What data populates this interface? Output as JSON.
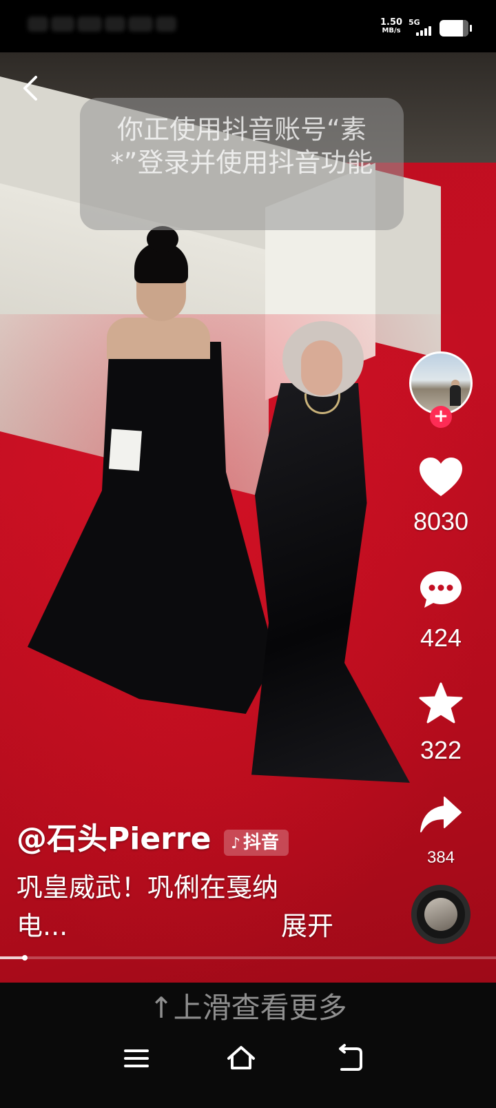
{
  "status_bar": {
    "net_speed": "1.50",
    "net_speed_unit": "MB/s",
    "network": "5G",
    "battery_level": 0.8
  },
  "toast": {
    "text": "你正使用抖音账号“素*”登录并使用抖音功能"
  },
  "actions": {
    "likes": "8030",
    "comments": "424",
    "favorites": "322",
    "shares": "384"
  },
  "post": {
    "author": "@石头Pierre",
    "app_badge": "抖音",
    "description_line1": "巩皇威武！巩俐在戛纳",
    "description_line2": "电...",
    "expand_label": "展开",
    "progress": 0.05
  },
  "footer": {
    "swipe_hint": "↑上滑查看更多"
  },
  "colors": {
    "follow_accent": "#fe2c55",
    "carpet_red": "#c30f22"
  },
  "icons": [
    "back-arrow",
    "heart",
    "comment-bubble",
    "star",
    "share-arrow",
    "music-disc",
    "menu",
    "home",
    "return"
  ]
}
